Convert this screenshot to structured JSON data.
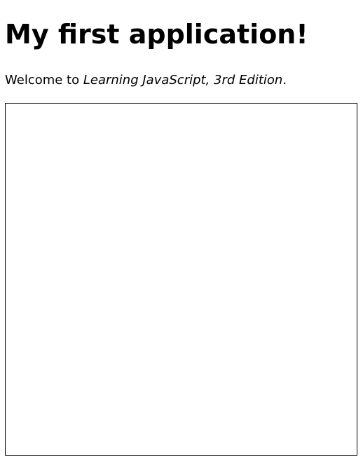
{
  "heading": "My first application!",
  "intro": {
    "prefix": "Welcome to ",
    "book_title": "Learning JavaScript, 3rd Edition",
    "suffix": "."
  }
}
